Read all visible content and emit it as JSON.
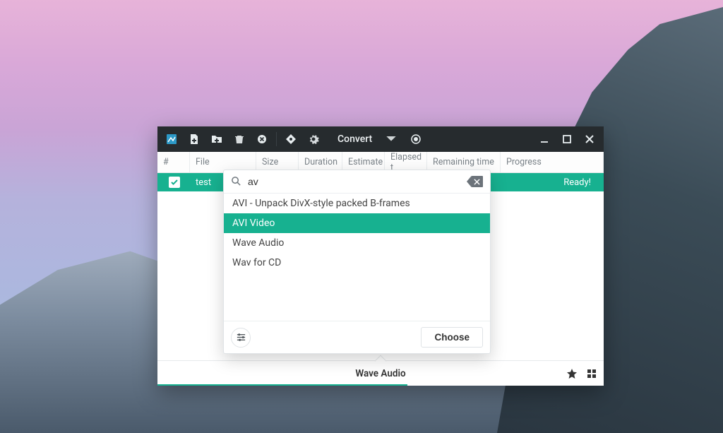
{
  "toolbar": {
    "action_label": "Convert",
    "icons": [
      "app-icon",
      "add-file-icon",
      "add-folder-icon",
      "trash-icon",
      "stop-icon",
      "diamond-icon",
      "gear-icon",
      "dropdown-arrow-icon",
      "record-icon"
    ],
    "window_controls": [
      "minimize-icon",
      "maximize-icon",
      "close-icon"
    ]
  },
  "columns": {
    "idx": "#",
    "file": "File",
    "size": "Size",
    "duration": "Duration",
    "estimate": "Estimate",
    "elapsed": "Elapsed t",
    "remaining": "Remaining time",
    "progress": "Progress"
  },
  "rows": [
    {
      "checked": true,
      "file": "test",
      "status": "Ready!"
    }
  ],
  "search": {
    "query": "av",
    "placeholder": "",
    "options": [
      {
        "label": "AVI - Unpack DivX-style packed B-frames",
        "selected": false
      },
      {
        "label": "AVI Video",
        "selected": true
      },
      {
        "label": "Wave Audio",
        "selected": false
      },
      {
        "label": "Wav for CD",
        "selected": false
      }
    ],
    "choose_label": "Choose"
  },
  "footer": {
    "format": "Wave Audio"
  },
  "colors": {
    "accent": "#17b190",
    "titlebar": "#262b2e"
  }
}
